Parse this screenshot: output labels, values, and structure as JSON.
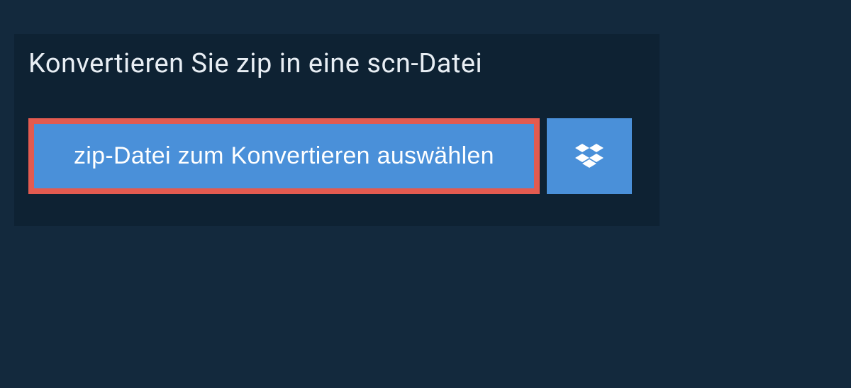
{
  "header": {
    "title": "Konvertieren Sie zip in eine scn-Datei"
  },
  "actions": {
    "choose_file_label": "zip-Datei zum Konvertieren auswählen"
  },
  "colors": {
    "background": "#13293d",
    "panel": "#0e2233",
    "button": "#4a90d9",
    "highlight_border": "#e35b50"
  }
}
